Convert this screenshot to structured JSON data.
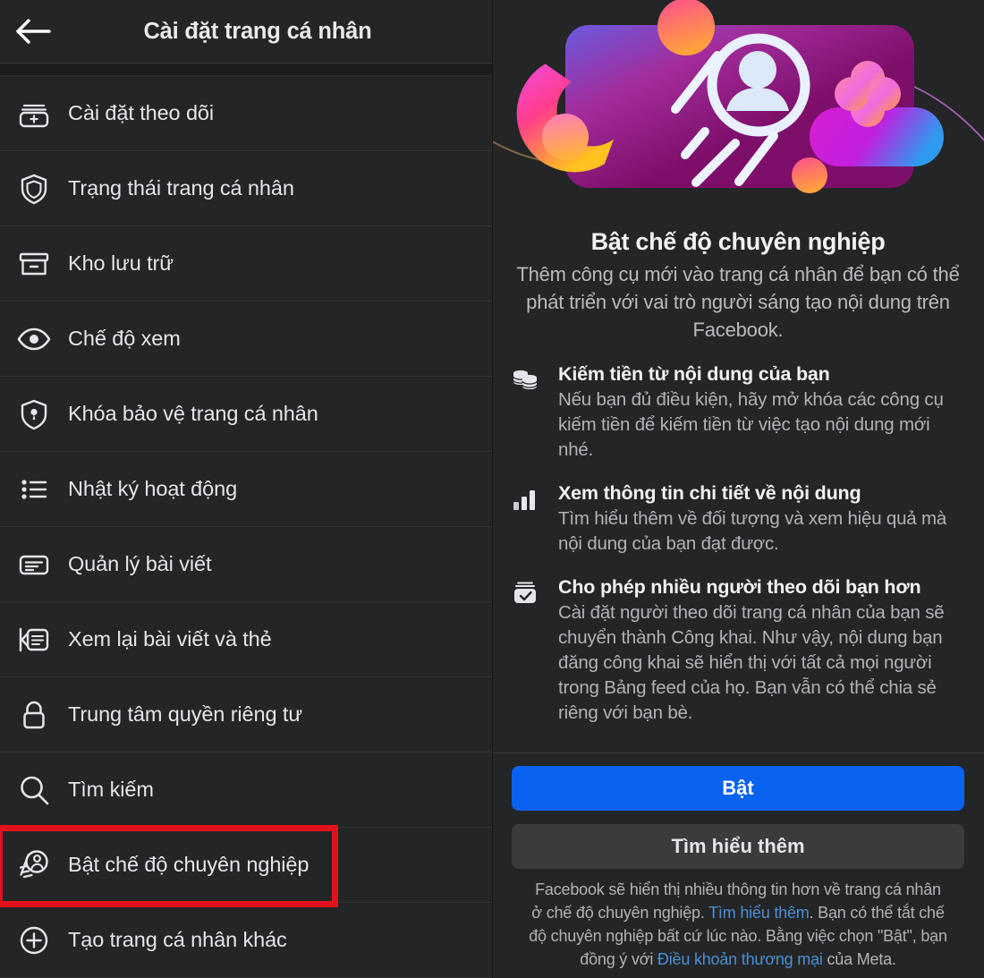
{
  "header": {
    "title": "Cài đặt trang cá nhân",
    "back_icon": "arrow-left-icon"
  },
  "sidebar": {
    "items": [
      {
        "label": "Cài đặt theo dõi",
        "icon": "follow-settings-icon"
      },
      {
        "label": "Trạng thái trang cá nhân",
        "icon": "shield-icon"
      },
      {
        "label": "Kho lưu trữ",
        "icon": "archive-box-icon"
      },
      {
        "label": "Chế độ xem",
        "icon": "eye-icon"
      },
      {
        "label": "Khóa bảo vệ trang cá nhân",
        "icon": "shield-lock-icon"
      },
      {
        "label": "Nhật ký hoạt động",
        "icon": "activity-list-icon"
      },
      {
        "label": "Quản lý bài viết",
        "icon": "manage-posts-icon"
      },
      {
        "label": "Xem lại bài viết và thẻ",
        "icon": "review-posts-tags-icon"
      },
      {
        "label": "Trung tâm quyền riêng tư",
        "icon": "padlock-icon"
      },
      {
        "label": "Tìm kiếm",
        "icon": "search-icon"
      },
      {
        "label": "Bật chế độ chuyên nghiệp",
        "icon": "professional-mode-icon",
        "highlighted": true
      },
      {
        "label": "Tạo trang cá nhân khác",
        "icon": "plus-circle-icon"
      }
    ]
  },
  "detail": {
    "hero_icon": "professional-mode-illustration",
    "title": "Bật chế độ chuyên nghiệp",
    "subtitle": "Thêm công cụ mới vào trang cá nhân để bạn có thể phát triển với vai trò người sáng tạo nội dung trên Facebook.",
    "features": [
      {
        "icon": "coins-stack-icon",
        "title": "Kiếm tiền từ nội dung của bạn",
        "description": "Nếu bạn đủ điều kiện, hãy mở khóa các công cụ kiếm tiền để kiếm tiền từ việc tạo nội dung mới nhé."
      },
      {
        "icon": "bar-chart-icon",
        "title": "Xem thông tin chi tiết về nội dung",
        "description": "Tìm hiểu thêm về đối tượng và xem hiệu quả mà nội dung của bạn đạt được."
      },
      {
        "icon": "followers-check-icon",
        "title": "Cho phép nhiều người theo dõi bạn hơn",
        "description": "Cài đặt người theo dõi trang cá nhân của bạn sẽ chuyển thành Công khai. Như vậy, nội dung bạn đăng công khai sẽ hiển thị với tất cả mọi người trong Bảng feed của họ. Bạn vẫn có thể chia sẻ riêng với bạn bè."
      }
    ],
    "primary_button": "Bật",
    "secondary_button": "Tìm hiểu thêm",
    "legal": {
      "part1": "Facebook sẽ hiển thị nhiều thông tin hơn về trang cá nhân ở chế độ chuyên nghiệp. ",
      "link1": "Tìm hiểu thêm",
      "part2": ". Bạn có thể tắt chế độ chuyên nghiệp bất cứ lúc nào. Bằng việc chọn \"Bật\", bạn đồng ý với ",
      "link2": "Điều khoản thương mại",
      "part3": " của Meta."
    }
  },
  "colors": {
    "background": "#18191a",
    "surface": "#242526",
    "primary_blue": "#0a62f0",
    "secondary_gray": "#3a3b3c",
    "link_blue": "#4a8fd4",
    "highlight_red": "#e2111b"
  }
}
